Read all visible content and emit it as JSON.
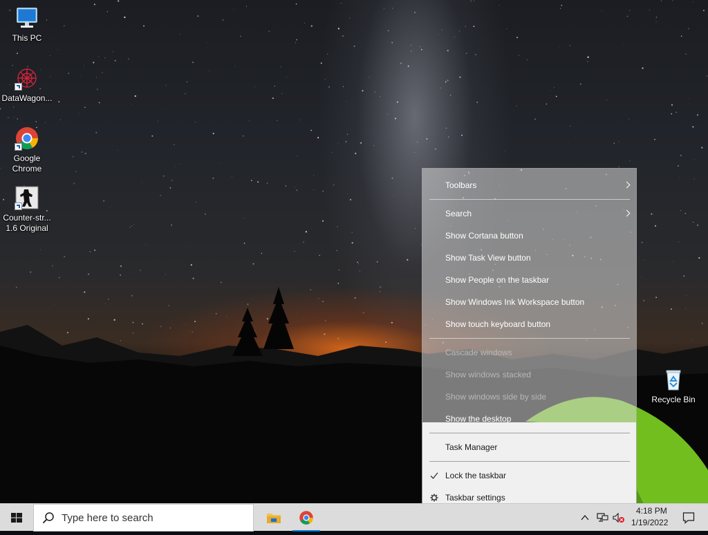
{
  "desktop": {
    "icons": [
      {
        "label": "This PC",
        "icon": "computer-icon"
      },
      {
        "label": "DataWagon...",
        "icon": "datawagon-icon"
      },
      {
        "label": "Google\nChrome",
        "icon": "chrome-icon"
      },
      {
        "label": "Counter-str...\n1.6 Original",
        "icon": "counter-strike-icon"
      },
      {
        "label": "Recycle Bin",
        "icon": "recycle-bin-icon"
      }
    ]
  },
  "context_menu": {
    "items": [
      {
        "label": "Toolbars",
        "submenu": true
      },
      {
        "label": "Search",
        "submenu": true
      },
      {
        "label": "Show Cortana button"
      },
      {
        "label": "Show Task View button"
      },
      {
        "label": "Show People on the taskbar"
      },
      {
        "label": "Show Windows Ink Workspace button"
      },
      {
        "label": "Show touch keyboard button"
      },
      {
        "label": "Cascade windows",
        "disabled": true
      },
      {
        "label": "Show windows stacked",
        "disabled": true
      },
      {
        "label": "Show windows side by side",
        "disabled": true
      },
      {
        "label": "Show the desktop"
      },
      {
        "label": "Task Manager"
      },
      {
        "label": "Lock the taskbar",
        "checked": true
      },
      {
        "label": "Taskbar settings",
        "icon": "gear-icon"
      }
    ]
  },
  "taskbar": {
    "search_placeholder": "Type here to search",
    "apps": [
      {
        "name": "File Explorer",
        "icon": "folder-icon"
      },
      {
        "name": "Google Chrome",
        "icon": "chrome-icon"
      }
    ],
    "clock_time": "4:18 PM",
    "clock_date": "1/19/2022"
  },
  "colors": {
    "taskbar": "#dcdcdc",
    "menu_solid": "#f0f0f0",
    "accent_blue": "#0078d7",
    "tent_green": "#7ed321"
  }
}
